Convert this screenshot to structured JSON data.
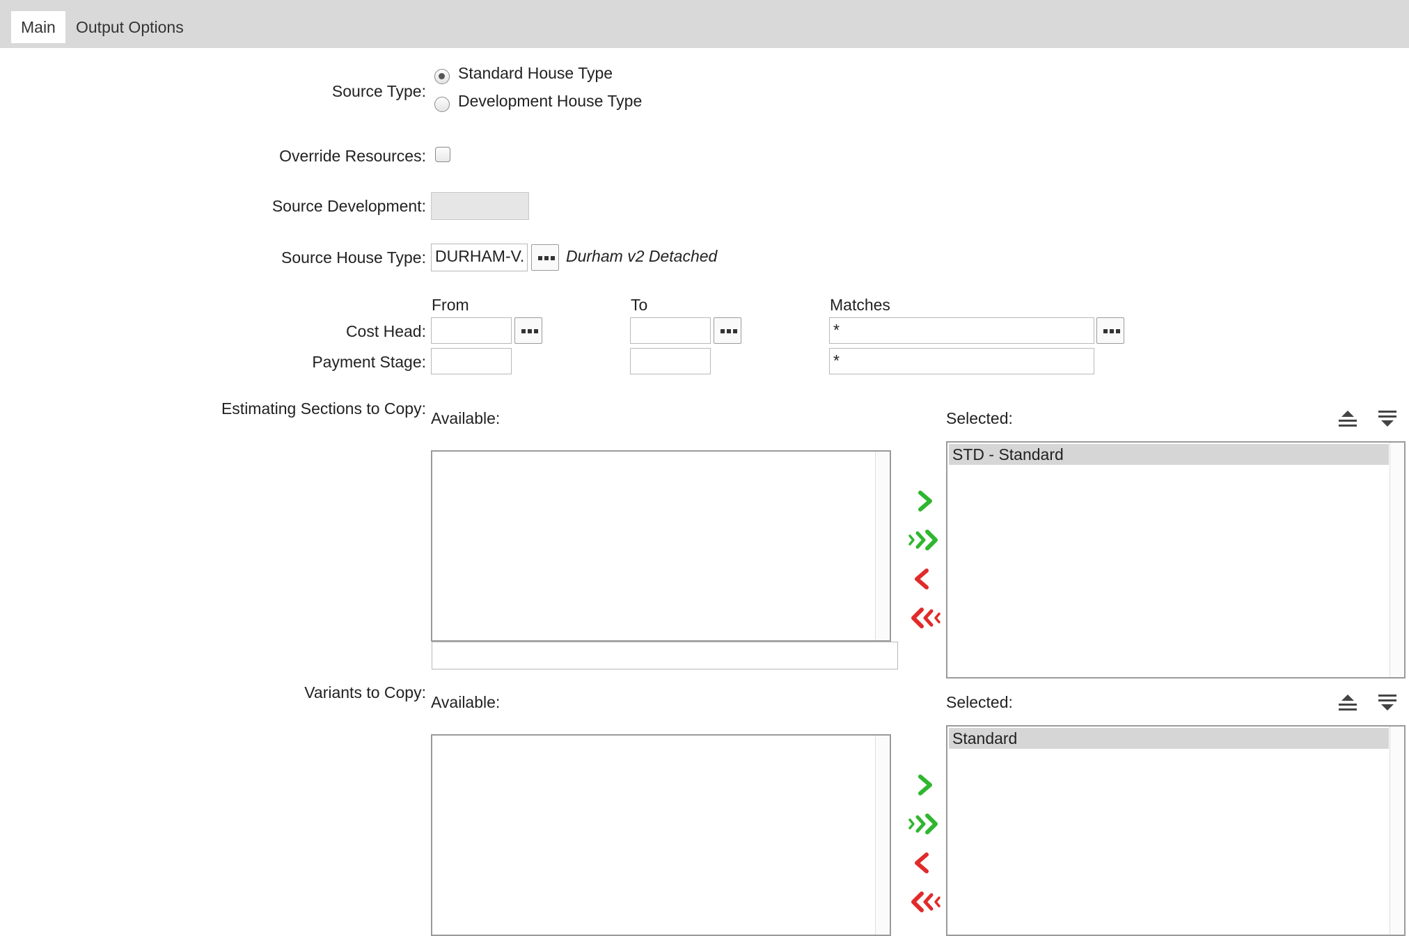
{
  "tabs": [
    {
      "label": "Main",
      "active": true
    },
    {
      "label": "Output Options",
      "active": false
    }
  ],
  "form": {
    "source_type": {
      "label": "Source Type:",
      "options": [
        "Standard House Type",
        "Development House Type"
      ],
      "selected": "Standard House Type"
    },
    "override_resources": {
      "label": "Override Resources:",
      "checked": false
    },
    "source_development": {
      "label": "Source Development:",
      "value": ""
    },
    "source_house_type": {
      "label": "Source House Type:",
      "value": "DURHAM-V.",
      "description": "Durham v2 Detached"
    },
    "range_headers": {
      "from": "From",
      "to": "To",
      "matches": "Matches"
    },
    "cost_head": {
      "label": "Cost Head:",
      "from": "",
      "to": "",
      "matches": "*"
    },
    "payment_stage": {
      "label": "Payment Stage:",
      "from": "",
      "to": "",
      "matches": "*"
    }
  },
  "estimating_sections": {
    "label": "Estimating Sections to Copy:",
    "available_label": "Available:",
    "selected_label": "Selected:",
    "available_items": [],
    "filter_value": "",
    "selected_items": [
      "STD - Standard"
    ]
  },
  "variants": {
    "label": "Variants to Copy:",
    "available_label": "Available:",
    "selected_label": "Selected:",
    "available_items": [],
    "selected_items": [
      "Standard"
    ]
  },
  "colors": {
    "tabbar_bg": "#d9d9d9",
    "add_arrow": "#2fb62f",
    "remove_arrow": "#e02b2b",
    "selected_item_bg": "#d6d6d6"
  },
  "icons": {
    "lookup": "ellipsis-icon",
    "add_one": "chevron-right-icon",
    "add_all": "double-chevron-right-icon",
    "remove_one": "chevron-left-icon",
    "remove_all": "double-chevron-left-icon",
    "move_top": "move-to-top-icon",
    "move_bottom": "move-to-bottom-icon"
  }
}
